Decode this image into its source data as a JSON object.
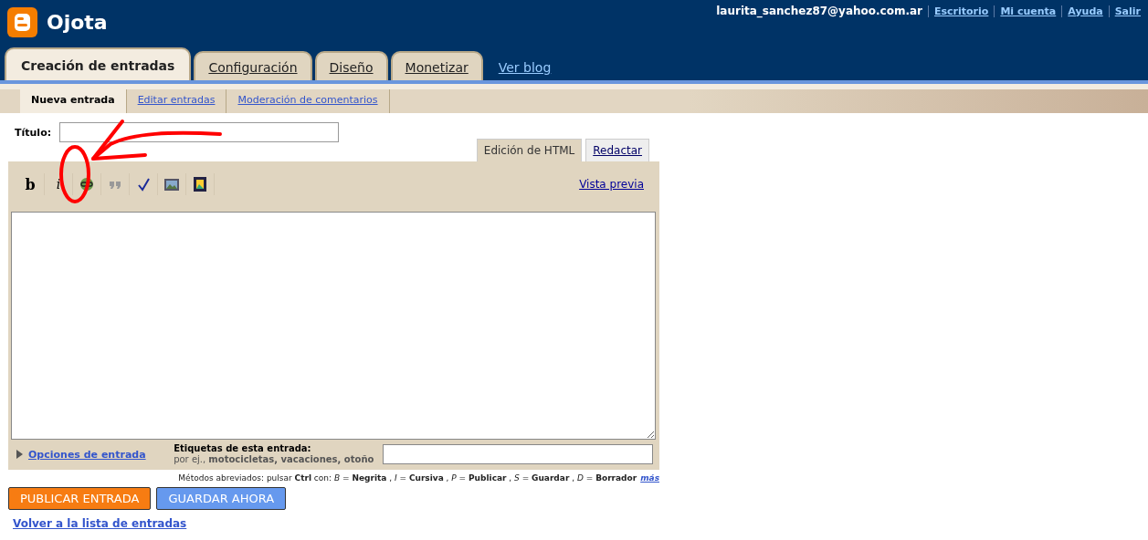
{
  "header": {
    "blog_title": "Ojota",
    "user": "laurita_sanchez87@yahoo.com.ar",
    "links": [
      "Escritorio",
      "Mi cuenta",
      "Ayuda",
      "Salir"
    ]
  },
  "tabs": [
    {
      "label": "Creación de entradas",
      "selected": true
    },
    {
      "label": "Configuración",
      "selected": false
    },
    {
      "label": "Diseño",
      "selected": false
    },
    {
      "label": "Monetizar",
      "selected": false
    }
  ],
  "view_blog_link": "Ver blog",
  "subtabs": [
    {
      "label": "Nueva entrada",
      "selected": true
    },
    {
      "label": "Editar entradas",
      "selected": false
    },
    {
      "label": "Moderación de comentarios",
      "selected": false
    }
  ],
  "title_field": {
    "label": "Título:"
  },
  "editor_tabs": [
    {
      "label": "Edición de HTML",
      "selected": true
    },
    {
      "label": "Redactar",
      "selected": false
    }
  ],
  "toolbar": [
    {
      "kind": "bold",
      "label": "b"
    },
    {
      "kind": "italic",
      "label": "i"
    },
    {
      "kind": "link"
    },
    {
      "kind": "quote"
    },
    {
      "kind": "spellcheck"
    },
    {
      "kind": "image"
    },
    {
      "kind": "video"
    }
  ],
  "preview_link": "Vista previa",
  "options_link": "Opciones de entrada",
  "labels_field": {
    "label": "Etiquetas de esta entrada:",
    "hint": "por ej., **motocicletas, vacaciones, otoño**"
  },
  "shortcuts": "Métodos abreviados: pulsar **Ctrl** con: *B* = **Negrita** , *I* = **Cursiva** , *P* = **Publicar** , *S* = **Guardar** , *D* = **Borrador**",
  "shortcuts_more": "más",
  "buttons": [
    {
      "kind": "publish",
      "label": "PUBLICAR ENTRADA"
    },
    {
      "kind": "save",
      "label": "GUARDAR AHORA"
    }
  ],
  "back_link": "Volver a la lista de entradas"
}
